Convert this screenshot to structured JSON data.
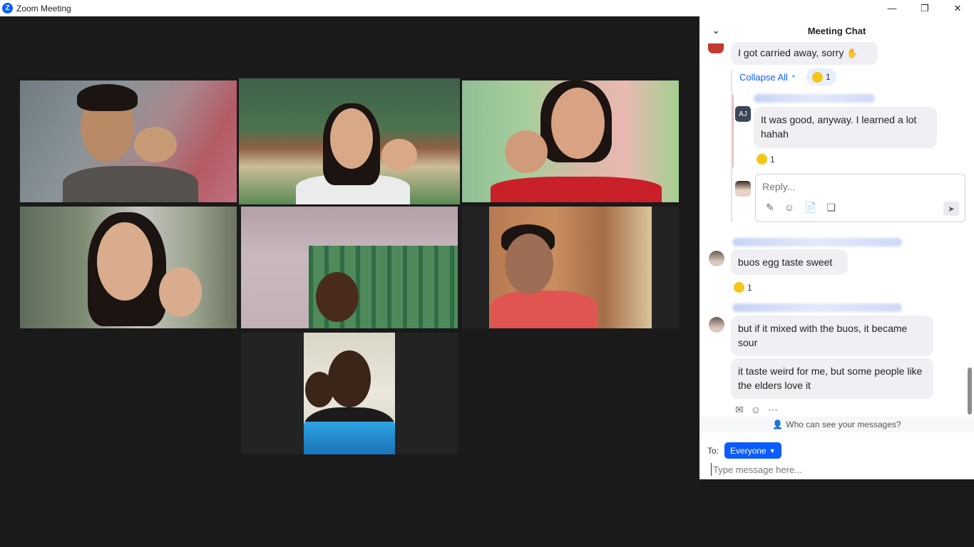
{
  "window": {
    "title": "Zoom Meeting",
    "logo": "Z",
    "minimize": "—",
    "restore": "❐",
    "close": "✕"
  },
  "chat": {
    "header": "Meeting Chat",
    "messages": [
      {
        "text": "I got carried away, sorry",
        "emoji": "✋"
      },
      {
        "collapse_label": "Collapse All",
        "reaction_count": "1"
      },
      {
        "avatar_initials": "AJ",
        "text": "It was good, anyway. I learned a lot hahah",
        "reaction_count": "1"
      },
      {
        "text": "buos egg taste sweet",
        "reaction_count": "1"
      },
      {
        "text": "but if it mixed with the buos, it became sour"
      },
      {
        "text": "it taste weird for me, but some people like the elders love it"
      }
    ],
    "reply_placeholder": "Reply...",
    "who_can_see": "Who can see your messages?",
    "to_label": "To:",
    "to_value": "Everyone",
    "input_placeholder": "Type message here..."
  },
  "colors": {
    "accent": "#0b5cff",
    "active_speaker": "#dbe88a"
  }
}
